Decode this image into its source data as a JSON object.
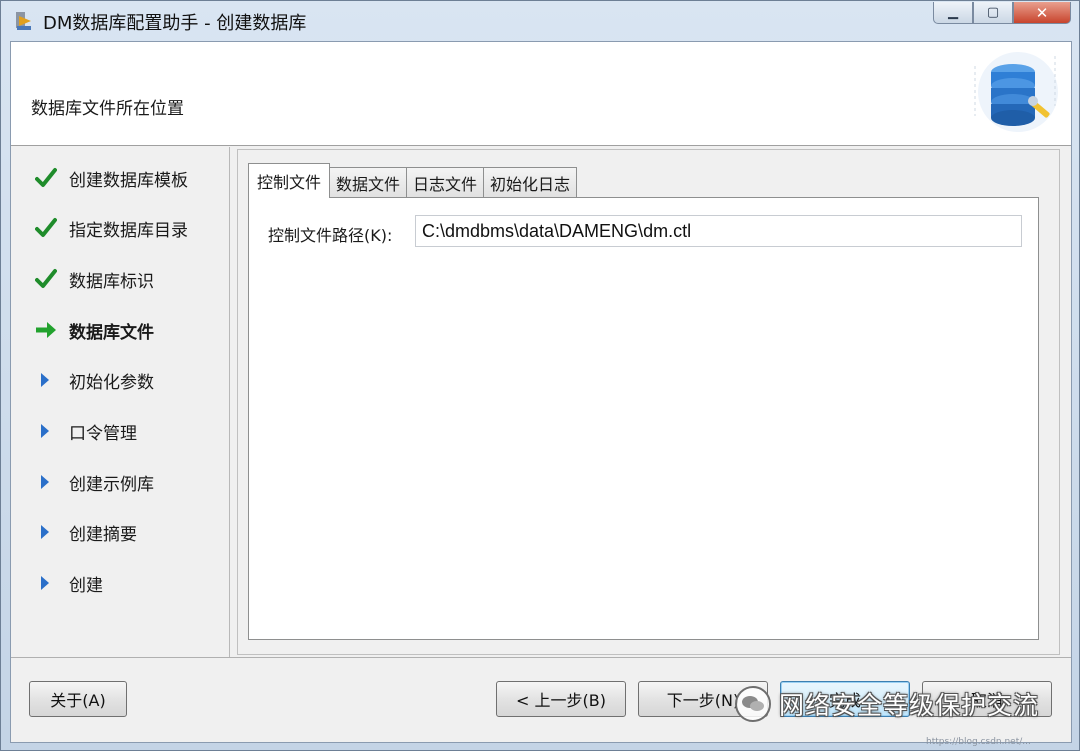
{
  "window": {
    "title": "DM数据库配置助手 - 创建数据库",
    "controls": {
      "minimize": "▁",
      "maximize": "▢",
      "close": "✕"
    }
  },
  "header": {
    "title": "数据库文件所在位置",
    "art_icon": "database-wrench-icon"
  },
  "steps": [
    {
      "label": "创建数据库模板",
      "state": "done",
      "icon": "check-icon"
    },
    {
      "label": "指定数据库目录",
      "state": "done",
      "icon": "check-icon"
    },
    {
      "label": "数据库标识",
      "state": "done",
      "icon": "check-icon"
    },
    {
      "label": "数据库文件",
      "state": "current",
      "icon": "arrow-right-icon"
    },
    {
      "label": "初始化参数",
      "state": "pending",
      "icon": "triangle-right-icon"
    },
    {
      "label": "口令管理",
      "state": "pending",
      "icon": "triangle-right-icon"
    },
    {
      "label": "创建示例库",
      "state": "pending",
      "icon": "triangle-right-icon"
    },
    {
      "label": "创建摘要",
      "state": "pending",
      "icon": "triangle-right-icon"
    },
    {
      "label": "创建",
      "state": "pending",
      "icon": "triangle-right-icon"
    }
  ],
  "tabs": [
    {
      "label": "控制文件",
      "active": true
    },
    {
      "label": "数据文件",
      "active": false
    },
    {
      "label": "日志文件",
      "active": false
    },
    {
      "label": "初始化日志",
      "active": false
    }
  ],
  "control_file": {
    "label": "控制文件路径(K):",
    "value": "C:\\dmdbms\\data\\DAMENG\\dm.ctl"
  },
  "buttons": {
    "about": "关于(A)",
    "back": "< 上一步(B)",
    "next": "下一步(N)",
    "finish": "完成",
    "cancel": "取消"
  },
  "watermark": {
    "text": "网络安全等级保护交流",
    "url": "https://blog.csdn.net/..."
  },
  "colors": {
    "check": "#1f8c2b",
    "arrow": "#22a22e",
    "triangle": "#2a6fc9",
    "title_bar": "#d9e5f2"
  }
}
